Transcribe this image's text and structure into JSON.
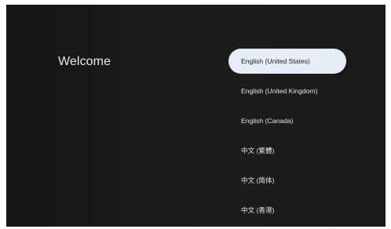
{
  "welcome": {
    "title": "Welcome"
  },
  "languages": {
    "selected_index": 0,
    "items": [
      {
        "label": "English (United States)"
      },
      {
        "label": "English (United Kingdom)"
      },
      {
        "label": "English (Canada)"
      },
      {
        "label": "中文 (繁體)"
      },
      {
        "label": "中文 (简体)"
      },
      {
        "label": "中文 (香港)"
      }
    ]
  },
  "colors": {
    "background": "#1a1a1a",
    "selected_pill": "#e6edf6",
    "text": "#e4e5e7"
  }
}
